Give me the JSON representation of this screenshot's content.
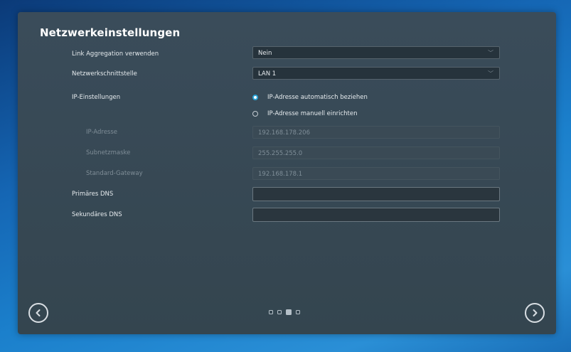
{
  "title": "Netzwerkeinstellungen",
  "fields": {
    "link_aggregation": {
      "label": "Link Aggregation verwenden",
      "value": "Nein"
    },
    "interface": {
      "label": "Netzwerkschnittstelle",
      "value": "LAN 1"
    },
    "ip_settings": {
      "label": "IP-Einstellungen",
      "options": [
        "IP-Adresse automatisch beziehen",
        "IP-Adresse manuell einrichten"
      ],
      "selected": "IP-Adresse automatisch beziehen"
    },
    "ip_address": {
      "label": "IP-Adresse",
      "value": "192.168.178.206"
    },
    "subnet_mask": {
      "label": "Subnetzmaske",
      "value": "255.255.255.0"
    },
    "gateway": {
      "label": "Standard-Gateway",
      "value": "192.168.178.1"
    },
    "primary_dns": {
      "label": "Primäres DNS",
      "value": ""
    },
    "secondary_dns": {
      "label": "Sekundäres DNS",
      "value": ""
    }
  },
  "pagination": {
    "total": 4,
    "current": 3
  },
  "icons": {
    "prev": "chevron-left-circle-icon",
    "next": "chevron-right-circle-icon",
    "dropdown": "chevron-down-icon"
  },
  "colors": {
    "accent": "#2aa3d6",
    "panel": "#34454f",
    "background": "#1566b4"
  }
}
